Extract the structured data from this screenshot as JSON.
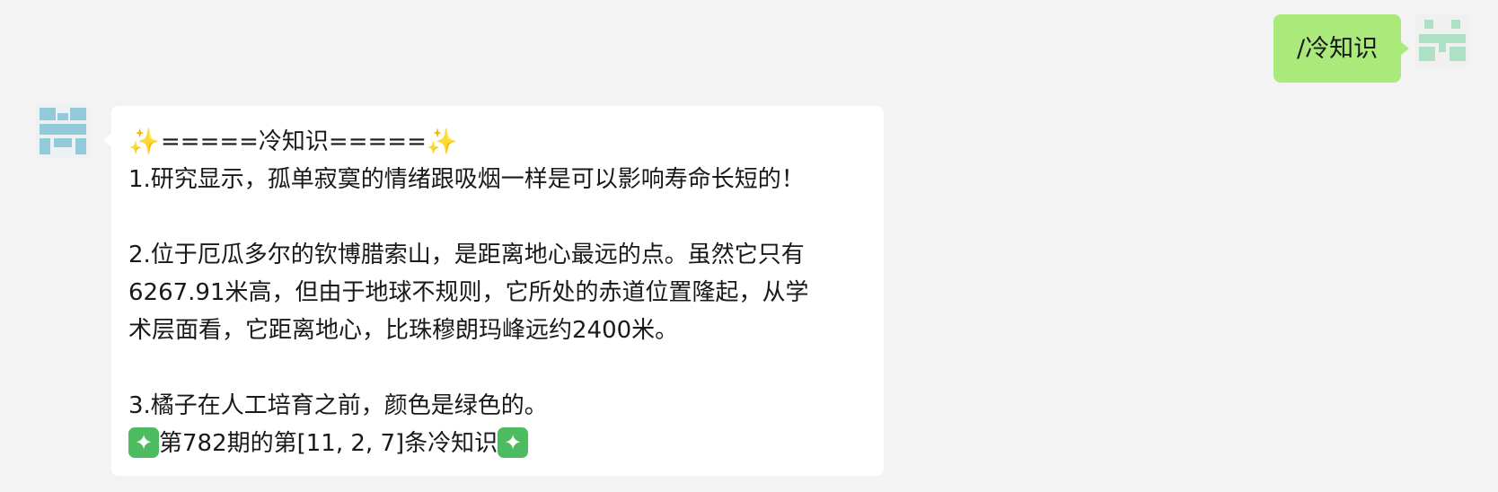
{
  "outgoing_message": {
    "text": "/冷知识"
  },
  "incoming_message": {
    "header": "=====冷知识=====",
    "header_icon": "sparkles-icon",
    "lines": [
      "1.研究显示，孤单寂寞的情绪跟吸烟一样是可以影响寿命长短的！",
      "",
      "2.位于厄瓜多尔的钦博腊索山，是距离地心最远的点。虽然它只有",
      "6267.91米高，但由于地球不规则，它所处的赤道位置隆起，从学",
      "术层面看，它距离地心，比珠穆朗玛峰远约2400米。",
      "",
      "3.橘子在人工培育之前，颜色是绿色的。"
    ],
    "footer": "第782期的第[11, 2, 7]条冷知识",
    "footer_icon": "sparkle-box-icon"
  },
  "colors": {
    "background": "#f3f3f3",
    "outgoing_bubble": "#a9ea7a",
    "incoming_bubble": "#ffffff",
    "avatar_right": "#aee0c6",
    "avatar_left": "#93cad9"
  }
}
